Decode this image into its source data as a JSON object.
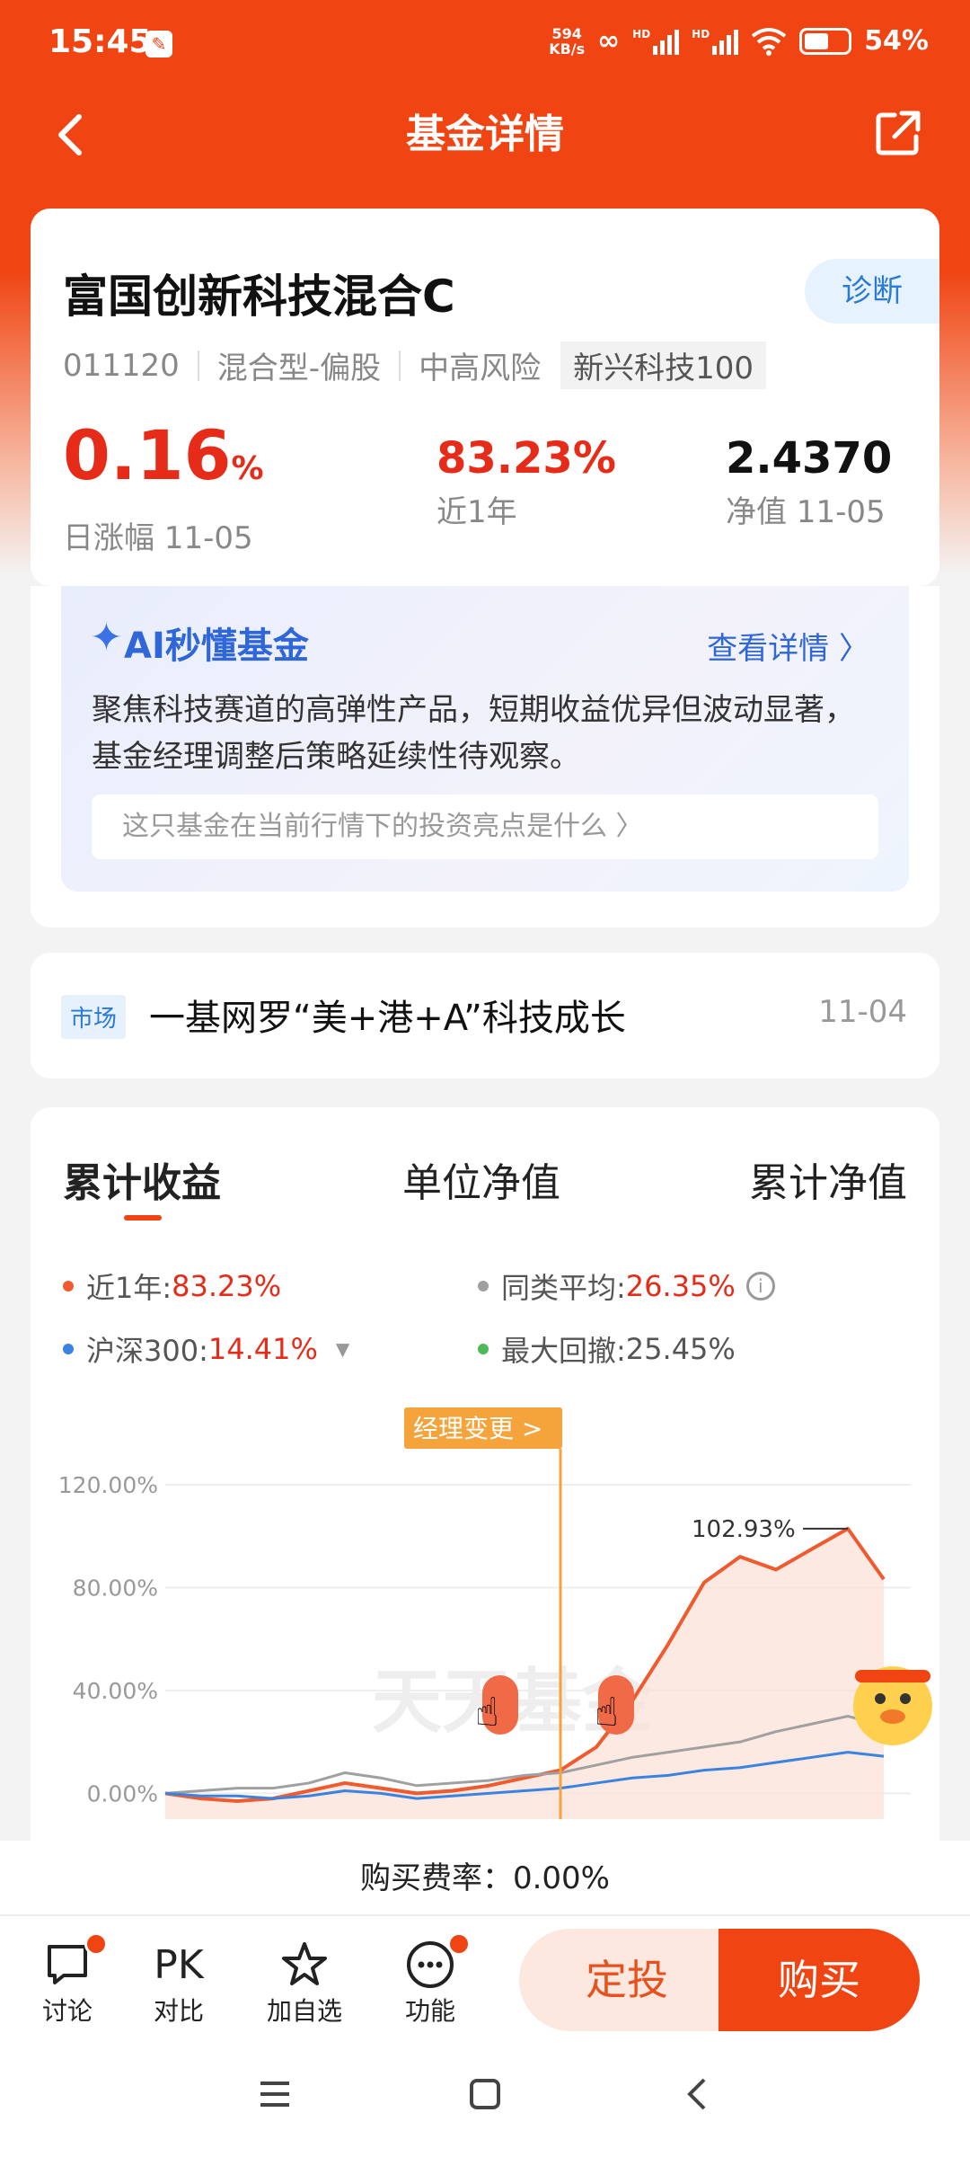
{
  "status": {
    "time": "15:45",
    "speed_top": "594",
    "speed_bottom": "KB/s",
    "battery": "54%",
    "hd1": "HD",
    "hd2": "HD"
  },
  "header": {
    "title": "基金详情"
  },
  "fund": {
    "name": "富国创新科技混合C",
    "diagnose_label": "诊断",
    "code": "011120",
    "type": "混合型-偏股",
    "risk": "中高风险",
    "tag": "新兴科技100",
    "daily_change": "0.16",
    "daily_change_unit": "%",
    "daily_change_label": "日涨幅 11-05",
    "year_return": "83.23%",
    "year_return_label": "近1年",
    "nav": "2.4370",
    "nav_label": "净值 11-05"
  },
  "ai": {
    "title": "AI秒懂基金",
    "more": "查看详情 〉",
    "summary": "聚焦科技赛道的高弹性产品，短期收益优异但波动显著，基金经理调整后策略延续性待观察。",
    "question": "这只基金在当前行情下的投资亮点是什么 〉"
  },
  "news": {
    "tag": "市场",
    "title": "一基网罗“美+港+A”科技成长",
    "date": "11-04"
  },
  "chart_tabs": [
    "累计收益",
    "单位净值",
    "累计净值"
  ],
  "legend": {
    "item1_label": "近1年:",
    "item1_value": "83.23%",
    "item2_label": "同类平均:",
    "item2_value": "26.35%",
    "item3_label": "沪深300:",
    "item3_value": "14.41%",
    "item4_label": "最大回撤:",
    "item4_value": "25.45%"
  },
  "colors": {
    "fund": "#ef5b2f",
    "peer": "#a0a0a0",
    "index": "#3b83e0",
    "drawdown": "#4cba58",
    "accent": "#f04412"
  },
  "chart_data": {
    "type": "line",
    "y_ticks": [
      "120.00%",
      "80.00%",
      "40.00%",
      "0.00%"
    ],
    "ylim": [
      0,
      120
    ],
    "x": [
      0,
      5,
      10,
      15,
      20,
      25,
      30,
      35,
      40,
      45,
      50,
      55,
      60,
      65,
      70,
      75,
      80,
      85,
      90,
      95,
      100
    ],
    "series": [
      {
        "name": "近1年",
        "values": [
          0,
          -2,
          -3,
          -2,
          1,
          4,
          2,
          0,
          1,
          3,
          6,
          9,
          18,
          36,
          58,
          82,
          92,
          87,
          95,
          102.93,
          83.23
        ]
      },
      {
        "name": "同类平均",
        "values": [
          0,
          1,
          2,
          2,
          4,
          8,
          6,
          3,
          4,
          5,
          7,
          8,
          11,
          14,
          16,
          18,
          20,
          24,
          27,
          30,
          26.35
        ]
      },
      {
        "name": "沪深300",
        "values": [
          0,
          -1,
          -1,
          -2,
          -1,
          1,
          0,
          -2,
          -1,
          0,
          1,
          2,
          4,
          6,
          7,
          9,
          10,
          12,
          14,
          16,
          14.41
        ]
      }
    ],
    "annotations": {
      "manager_change": "经理变更 >",
      "peak_label": "102.93%"
    }
  },
  "watermark": "天天基金",
  "fee": "购买费率：0.00%",
  "bottom": {
    "discuss": "讨论",
    "compare_icon": "PK",
    "compare": "对比",
    "watch": "加自选",
    "func": "功能",
    "fixed": "定投",
    "buy": "购买"
  }
}
